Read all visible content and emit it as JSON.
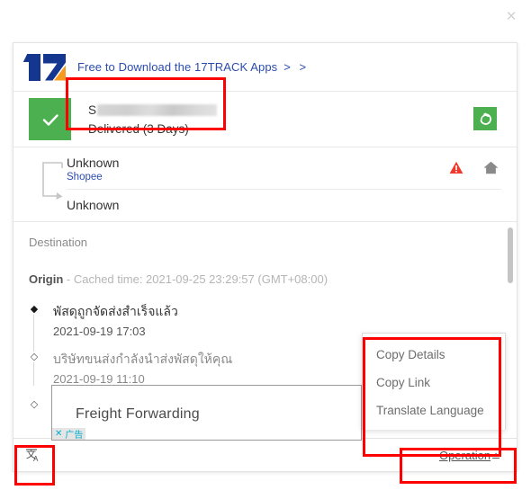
{
  "window": {
    "close_label": "×"
  },
  "promo": {
    "logo_text": "17",
    "text": "Free to Download the 17TRACK Apps",
    "arrows": "> >"
  },
  "status": {
    "icon": "check-icon",
    "tracking_number_visible": "S",
    "tracking_number_redacted": true,
    "delivered_text": "Delivered (3 Days)",
    "refresh_icon": "refresh-icon",
    "accent_green": "#4caf50"
  },
  "route": {
    "origin_label": "Unknown",
    "carrier": "Shopee",
    "destination_label": "Unknown",
    "warning_icon": "warning-triangle-icon",
    "home_icon": "home-icon",
    "warning_color": "#f0392b"
  },
  "details": {
    "destination_heading": "Destination",
    "origin_heading": "Origin",
    "cached_time": "- Cached time: 2021-09-25 23:29:57 (GMT+08:00)"
  },
  "timeline": [
    {
      "marker": "solid-diamond",
      "title": "พัสดุถูกจัดส่งสำเร็จแล้ว",
      "date": "2021-09-19 17:03"
    },
    {
      "marker": "hollow-diamond",
      "title": "บริษัทขนส่งกำลังนำส่งพัสดุให้คุณ",
      "date": "2021-09-19 11:10"
    },
    {
      "marker": "hollow-diamond",
      "title": "",
      "date": ""
    }
  ],
  "ad": {
    "title": "Freight Forwarding",
    "close_glyph": "✕",
    "label": "广告"
  },
  "context_menu": {
    "items": [
      {
        "label": "Copy Details"
      },
      {
        "label": "Copy Link"
      },
      {
        "label": "Translate Language"
      }
    ]
  },
  "footer": {
    "translate_icon": "translate-icon",
    "translate_glyph": "文",
    "translate_sub": "A",
    "operation_label": "Operation",
    "operation_caret": "▲"
  },
  "annotations": {
    "highlight_color": "#ff0000",
    "boxes": [
      "status-block",
      "context-menu",
      "translate-button",
      "operation-link"
    ]
  }
}
